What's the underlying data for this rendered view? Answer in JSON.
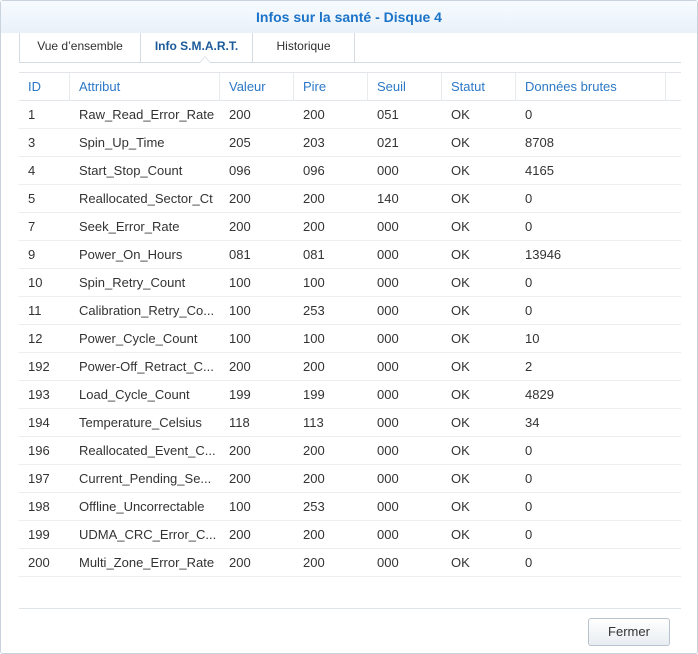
{
  "window": {
    "title": "Infos sur la santé - Disque 4"
  },
  "tabs": [
    {
      "label": "Vue d’ensemble",
      "active": false
    },
    {
      "label": "Info S.M.A.R.T.",
      "active": true
    },
    {
      "label": "Historique",
      "active": false
    }
  ],
  "table": {
    "columns": [
      "ID",
      "Attribut",
      "Valeur",
      "Pire",
      "Seuil",
      "Statut",
      "Données brutes"
    ],
    "rows": [
      [
        "1",
        "Raw_Read_Error_Rate",
        "200",
        "200",
        "051",
        "OK",
        "0"
      ],
      [
        "3",
        "Spin_Up_Time",
        "205",
        "203",
        "021",
        "OK",
        "8708"
      ],
      [
        "4",
        "Start_Stop_Count",
        "096",
        "096",
        "000",
        "OK",
        "4165"
      ],
      [
        "5",
        "Reallocated_Sector_Ct",
        "200",
        "200",
        "140",
        "OK",
        "0"
      ],
      [
        "7",
        "Seek_Error_Rate",
        "200",
        "200",
        "000",
        "OK",
        "0"
      ],
      [
        "9",
        "Power_On_Hours",
        "081",
        "081",
        "000",
        "OK",
        "13946"
      ],
      [
        "10",
        "Spin_Retry_Count",
        "100",
        "100",
        "000",
        "OK",
        "0"
      ],
      [
        "11",
        "Calibration_Retry_Co...",
        "100",
        "253",
        "000",
        "OK",
        "0"
      ],
      [
        "12",
        "Power_Cycle_Count",
        "100",
        "100",
        "000",
        "OK",
        "10"
      ],
      [
        "192",
        "Power-Off_Retract_C...",
        "200",
        "200",
        "000",
        "OK",
        "2"
      ],
      [
        "193",
        "Load_Cycle_Count",
        "199",
        "199",
        "000",
        "OK",
        "4829"
      ],
      [
        "194",
        "Temperature_Celsius",
        "118",
        "113",
        "000",
        "OK",
        "34"
      ],
      [
        "196",
        "Reallocated_Event_C...",
        "200",
        "200",
        "000",
        "OK",
        "0"
      ],
      [
        "197",
        "Current_Pending_Se...",
        "200",
        "200",
        "000",
        "OK",
        "0"
      ],
      [
        "198",
        "Offline_Uncorrectable",
        "100",
        "253",
        "000",
        "OK",
        "0"
      ],
      [
        "199",
        "UDMA_CRC_Error_C...",
        "200",
        "200",
        "000",
        "OK",
        "0"
      ],
      [
        "200",
        "Multi_Zone_Error_Rate",
        "200",
        "200",
        "000",
        "OK",
        "0"
      ]
    ]
  },
  "footer": {
    "close_label": "Fermer"
  }
}
